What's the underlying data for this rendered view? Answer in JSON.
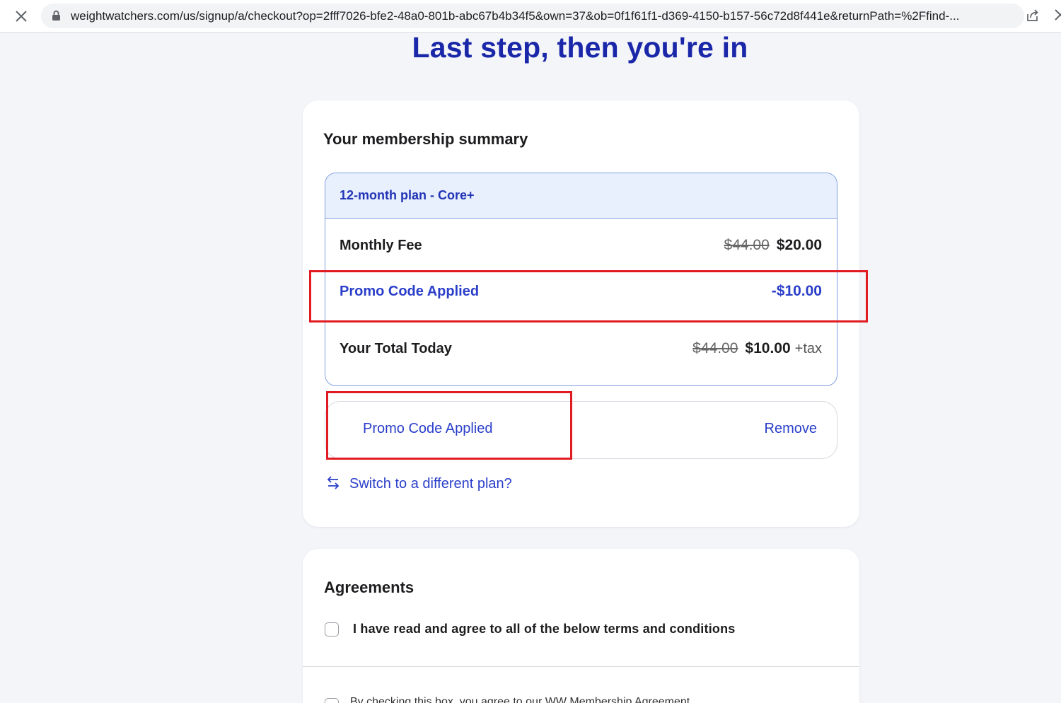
{
  "browser": {
    "url": "weightwatchers.com/us/signup/a/checkout?op=2fff7026-bfe2-48a0-801b-abc67b4b34f5&own=37&ob=0f1f61f1-d369-4150-b157-56c72d8f441e&returnPath=%2Ffind-..."
  },
  "page": {
    "title": "Last step, then you're in"
  },
  "summary": {
    "title": "Your membership summary",
    "plan_name": "12-month plan - Core+",
    "monthly_fee": {
      "label": "Monthly Fee",
      "original": "$44.00",
      "price": "$20.00"
    },
    "promo": {
      "label": "Promo Code Applied",
      "discount": "-$10.00"
    },
    "total": {
      "label": "Your Total Today",
      "original": "$44.00",
      "price": "$10.00",
      "suffix": "+tax"
    },
    "promo_field": {
      "value": "Promo Code Applied",
      "remove_label": "Remove"
    },
    "switch_plan_label": "Switch to a different plan?"
  },
  "agreements": {
    "title": "Agreements",
    "agree_all_label": "I have read and agree to all of the below terms and conditions",
    "next_item_label": "By checking this box, you agree to our WW Membership Agreement"
  },
  "colors": {
    "brand_blue": "#1a27a8",
    "link_blue": "#2a3ec9",
    "highlight_red": "#e11b22",
    "plan_header_bg": "#e8f0fe"
  }
}
